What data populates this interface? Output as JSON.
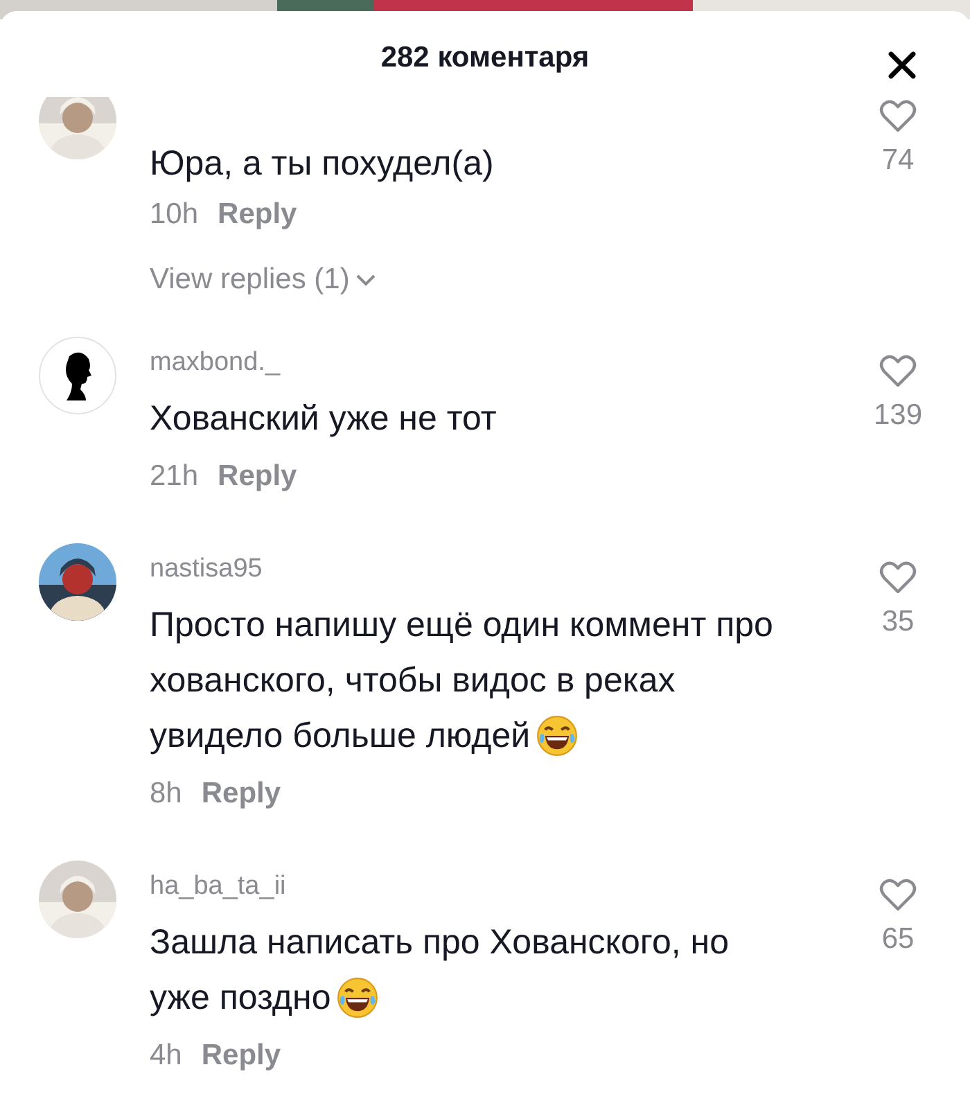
{
  "header": {
    "title": "282 коментаря"
  },
  "comments": [
    {
      "avatar": {
        "kind": "picture"
      },
      "lines": [
        "Юра, а ты похудел(а)"
      ],
      "emoji": false,
      "time": "10h",
      "reply": "Reply",
      "likes": "74",
      "view_replies": "View replies (1)"
    },
    {
      "username": "maxbond._",
      "avatar": {
        "kind": "silhouette"
      },
      "lines": [
        "Хованский уже не тот"
      ],
      "emoji": false,
      "time": "21h",
      "reply": "Reply",
      "likes": "139"
    },
    {
      "username": "nastisa95",
      "avatar": {
        "kind": "picture"
      },
      "lines": [
        "Просто напишу ещё один коммент про",
        "хованского, чтобы видос в реках",
        "увидело больше людей"
      ],
      "emoji": true,
      "time": "8h",
      "reply": "Reply",
      "likes": "35"
    },
    {
      "username": "ha_ba_ta_ii",
      "avatar": {
        "kind": "picture"
      },
      "lines": [
        "Зашла написать про Хованского, но",
        "уже поздно"
      ],
      "emoji": true,
      "time": "4h",
      "reply": "Reply",
      "likes": "65"
    }
  ]
}
